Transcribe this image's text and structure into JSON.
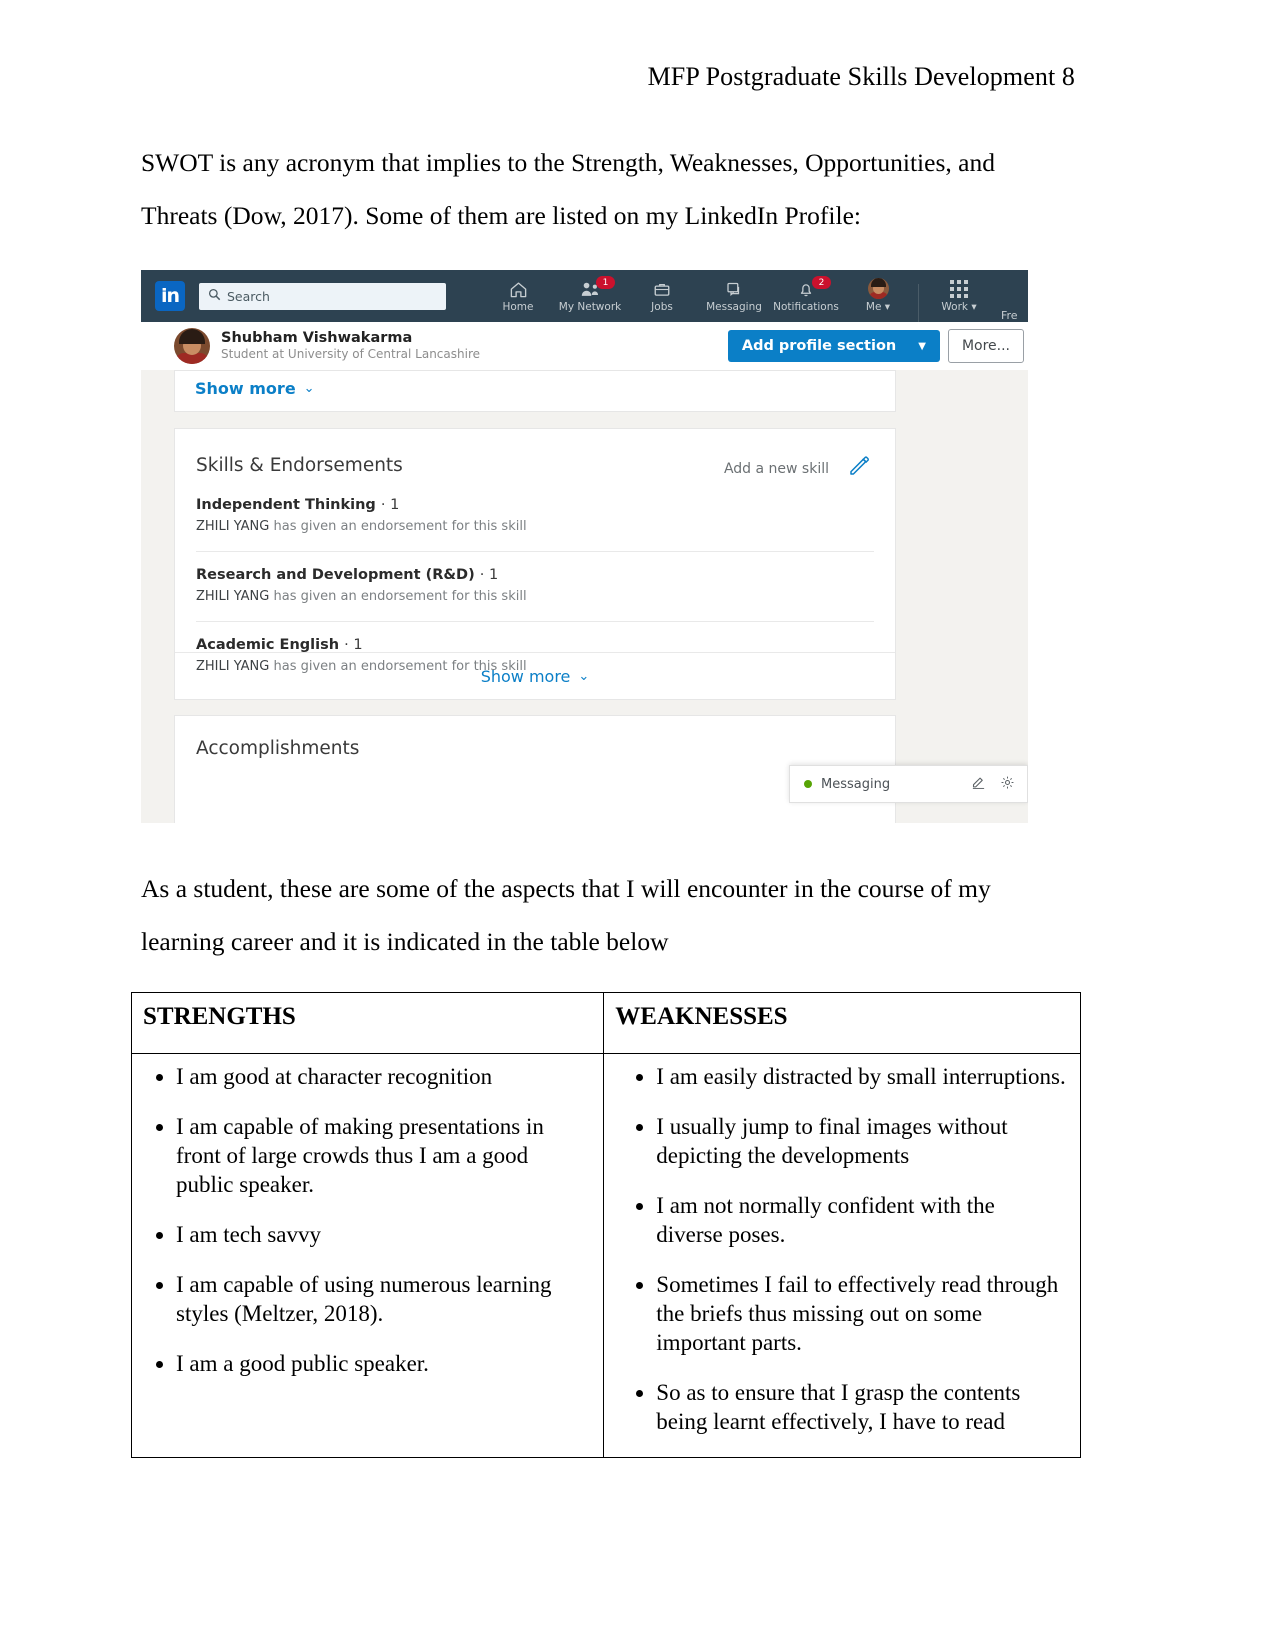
{
  "document": {
    "running_header": "MFP Postgraduate Skills Development 8",
    "paragraph_intro": "SWOT is any acronym that implies to the Strength, Weaknesses, Opportunities, and Threats (Dow, 2017). Some of them are listed on my LinkedIn Profile:",
    "paragraph_table_lead": "As a student, these are some of the aspects that I will encounter in the course of my learning career and it is indicated in the table below"
  },
  "linkedin": {
    "logo_text": "in",
    "search": {
      "placeholder": "Search",
      "value": "",
      "icon": "search-icon"
    },
    "nav_items": [
      {
        "label": "Home",
        "icon": "home-icon",
        "badge": ""
      },
      {
        "label": "My Network",
        "icon": "network-icon",
        "badge": "1"
      },
      {
        "label": "Jobs",
        "icon": "briefcase-icon",
        "badge": ""
      },
      {
        "label": "Messaging",
        "icon": "messaging-icon",
        "badge": ""
      },
      {
        "label": "Notifications",
        "icon": "bell-icon",
        "badge": "2"
      }
    ],
    "me_label": "Me",
    "work_label": "Work",
    "trailing_label": "Fre",
    "profile": {
      "name": "Shubham Vishwakarma",
      "headline": "Student at University of Central Lancashire",
      "add_profile_section": "Add profile section",
      "more": "More..."
    },
    "show_more_top": "Show more",
    "skills": {
      "title": "Skills & Endorsements",
      "add_new_skill": "Add a new skill",
      "edit_icon": "pencil-icon",
      "items": [
        {
          "name": "Independent Thinking",
          "count": "· 1",
          "endorser": "ZHILI YANG",
          "endorsement_text": "has given an endorsement for this skill"
        },
        {
          "name": "Research and Development (R&D)",
          "count": "· 1",
          "endorser": "ZHILI YANG",
          "endorsement_text": "has given an endorsement for this skill"
        },
        {
          "name": "Academic English",
          "count": "· 1",
          "endorser": "ZHILI YANG",
          "endorsement_text": "has given an endorsement for this skill"
        }
      ],
      "show_more": "Show more"
    },
    "accomplishments_title": "Accomplishments",
    "messaging_bar": {
      "label": "Messaging",
      "status_color": "#57a405",
      "compose_icon": "compose-icon",
      "settings_icon": "gear-icon"
    },
    "colors": {
      "nav_background": "#2d4251",
      "brand_blue": "#0a66c2",
      "link_blue": "#0b7fc7",
      "badge_red": "#cb112d",
      "page_background": "#f3f2ef"
    }
  },
  "swot_table": {
    "headers": [
      "STRENGTHS",
      "WEAKNESSES"
    ],
    "strengths": [
      "I am good at character recognition",
      "I am capable of making presentations in front of large crowds thus I am a good public speaker.",
      "I am tech savvy",
      "I am capable of using numerous learning styles (Meltzer, 2018).",
      "I am a good public speaker."
    ],
    "weaknesses": [
      "I am easily distracted by small interruptions.",
      "I usually jump to final images without depicting the developments",
      "I am not normally confident with the diverse poses.",
      "Sometimes I fail to effectively read through the briefs thus missing out on some important parts.",
      "So as to ensure that I grasp the contents being learnt effectively, I have to read"
    ]
  }
}
